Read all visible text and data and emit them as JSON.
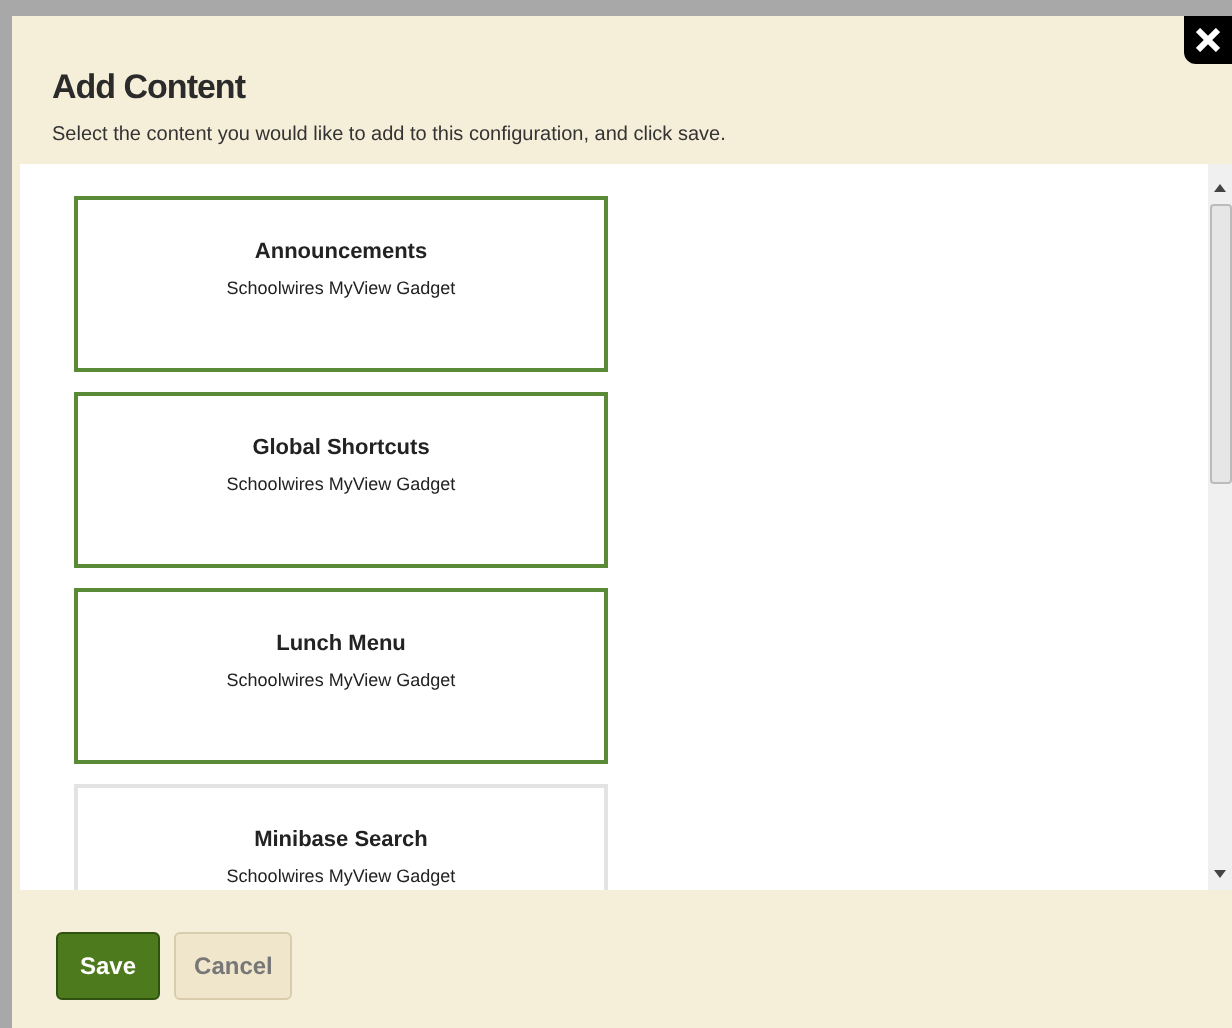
{
  "dialog": {
    "title": "Add Content",
    "instructions": "Select the content you would like to add to this configuration, and click save."
  },
  "items": [
    {
      "name": "Announcements",
      "source": "Schoolwires MyView Gadget",
      "selected": true
    },
    {
      "name": "Global Shortcuts",
      "source": "Schoolwires MyView Gadget",
      "selected": true
    },
    {
      "name": "Lunch Menu",
      "source": "Schoolwires MyView Gadget",
      "selected": true
    },
    {
      "name": "Minibase Search",
      "source": "Schoolwires MyView Gadget",
      "selected": false
    }
  ],
  "buttons": [
    {
      "label": "Save",
      "kind": "primary"
    },
    {
      "label": "Cancel",
      "kind": "secondary"
    }
  ]
}
